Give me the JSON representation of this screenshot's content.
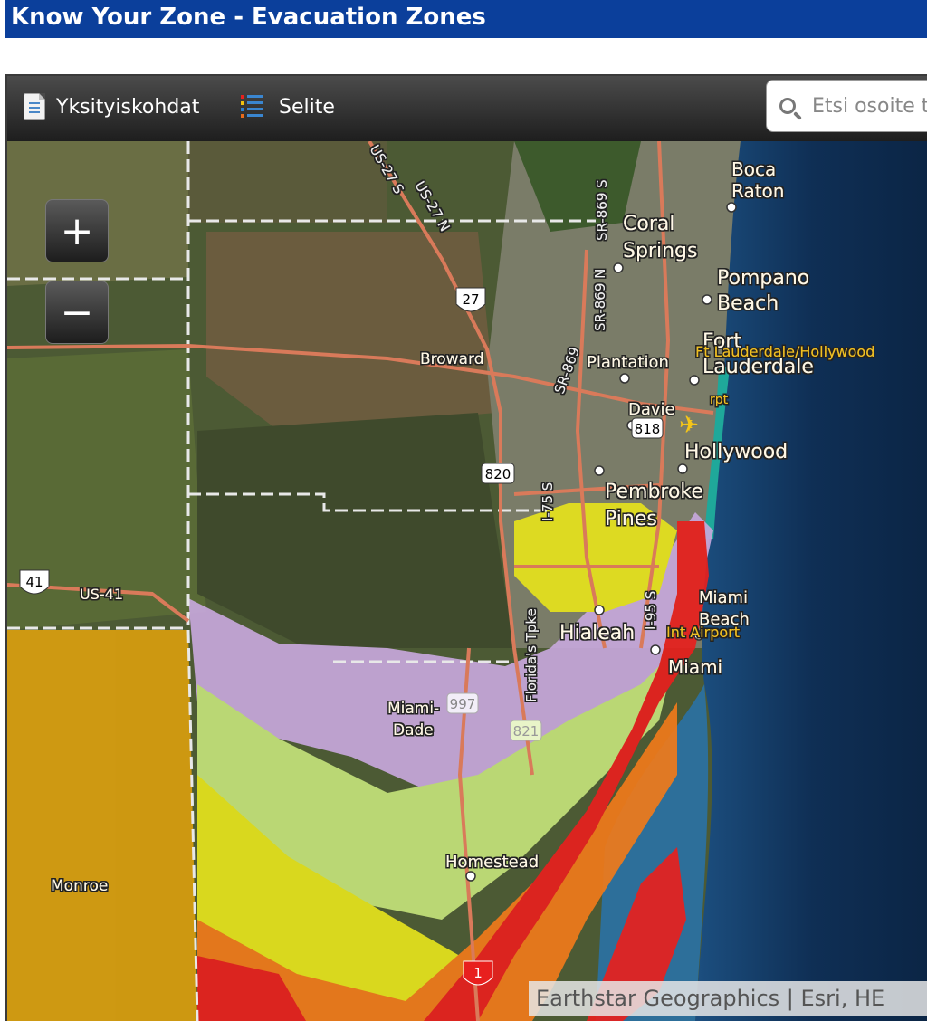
{
  "header": {
    "title": "Know Your Zone - Evacuation Zones"
  },
  "toolbar": {
    "details_label": "Yksityiskohdat",
    "legend_label": "Selite",
    "search_placeholder": "Etsi osoite t"
  },
  "zoom": {
    "in_label": "+",
    "out_label": "−"
  },
  "map": {
    "attribution": "Earthstar Geographics | Esri, HE",
    "zone_colors": [
      "#d99e0f",
      "#c7a8dc",
      "#c4e27a",
      "#e6e31d",
      "#f2c10e",
      "#f07a1a",
      "#e8201e"
    ],
    "labels": {
      "boca": "Boca",
      "raton": "Raton",
      "coral": "Coral",
      "springs": "Springs",
      "pompano": "Pompano",
      "pompano_beach": "Beach",
      "fort": "Fort",
      "lauderdale": "Lauderdale",
      "plantation": "Plantation",
      "ftl_airport": "Ft Lauderdale/Hollywood",
      "airport_short": "rpt",
      "davie": "Davie",
      "hollywood": "Hollywood",
      "pembroke": "Pembroke",
      "pines": "Pines",
      "miami_beach_1": "Miami",
      "miami_beach_2": "Beach",
      "miami_airport": "Int Airport",
      "hialeah": "Hialeah",
      "miami": "Miami",
      "miami_dade_1": "Miami-",
      "miami_dade_2": "Dade",
      "homestead": "Homestead",
      "monroe": "Monroe",
      "broward": "Broward",
      "us41": "US-41",
      "us27s": "US-27 S",
      "us27n": "US-27 N",
      "sr869s": "SR-869 S",
      "sr869n": "SR-869 N",
      "sr869b": "SR-869",
      "i75": "I-75 S",
      "i95": "I-95 S",
      "tpke": "Florida's Tpke",
      "shield_27": "27",
      "shield_41": "41",
      "shield_818": "818",
      "shield_820": "820",
      "shield_997": "997",
      "shield_821": "821",
      "shield_1": "1"
    }
  }
}
